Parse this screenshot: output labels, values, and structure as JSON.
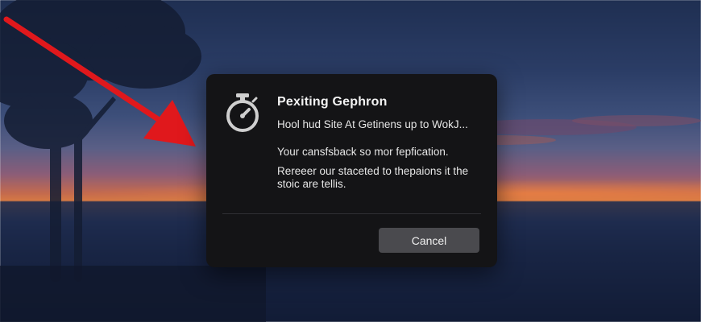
{
  "dialog": {
    "title": "Pexiting Gephron",
    "line_1": "Hool hud Site At Getinens up to WokJ...",
    "line_2": "Your cansfsback so mor fepfication.",
    "line_3": "Rereeer our staceted to thepaions it the",
    "line_4": "stoic are tellis.",
    "cancel_label": "Cancel",
    "icon": "stopwatch-icon"
  },
  "annotation": {
    "type": "arrow",
    "color": "#e0181c"
  },
  "background": {
    "scene": "blurred sunset landscape with tree silhouette"
  }
}
